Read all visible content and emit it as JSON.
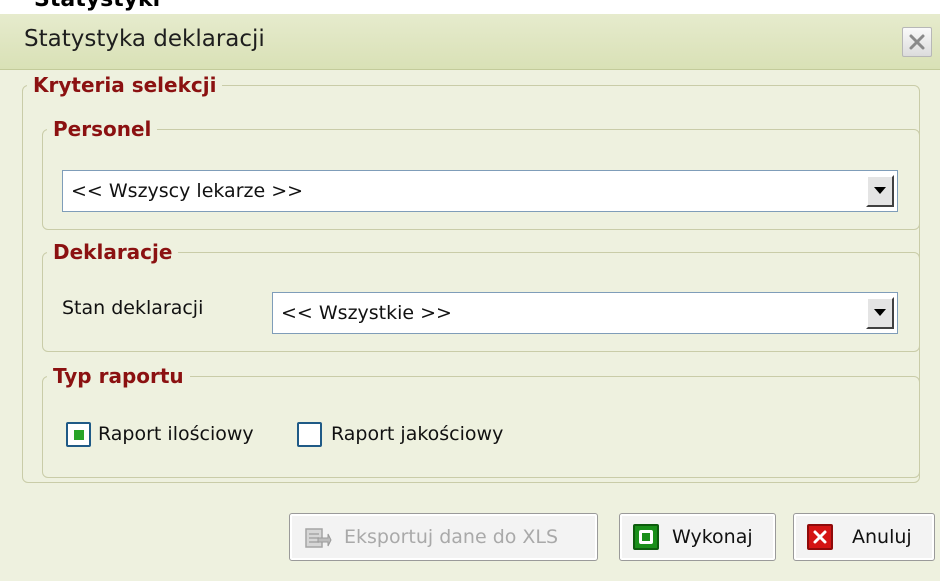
{
  "background": {
    "title_fragment": "Statystyki"
  },
  "dialog": {
    "title": "Statystyka deklaracji",
    "close_icon": "close-x-icon"
  },
  "groups": {
    "criteria": "Kryteria selekcji",
    "personel": {
      "legend": "Personel",
      "select_value": "<< Wszyscy lekarze >>"
    },
    "deklaracje": {
      "legend": "Deklaracje",
      "stan_label": "Stan deklaracji",
      "stan_value": "<< Wszystkie >>"
    },
    "typ_raportu": {
      "legend": "Typ raportu",
      "options": [
        {
          "label": "Raport ilościowy",
          "checked": true
        },
        {
          "label": "Raport jakościowy",
          "checked": false
        }
      ]
    }
  },
  "buttons": {
    "export": {
      "label": "Eksportuj dane do XLS",
      "enabled": false,
      "icon": "excel-export-icon"
    },
    "execute": {
      "label": "Wykonaj",
      "icon": "green-ok-icon"
    },
    "cancel": {
      "label": "Anuluj",
      "icon": "red-x-icon"
    }
  },
  "colors": {
    "dialog_bg": "#eef1df",
    "titlebar": "#dde4bd",
    "legend_text": "#8b1111",
    "check_mark": "#28a428",
    "ok_green": "#1a8f1a",
    "cancel_red": "#d41414"
  }
}
